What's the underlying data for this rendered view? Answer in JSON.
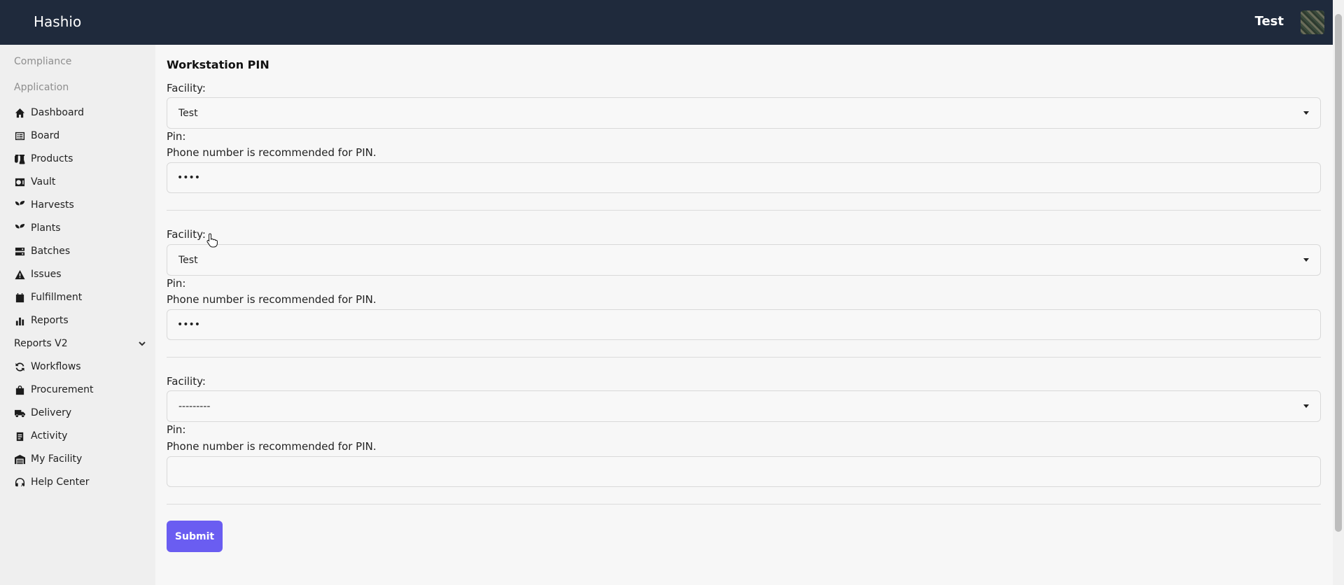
{
  "header": {
    "brand": "Hashio",
    "user_name": "Test"
  },
  "sidebar": {
    "section_compliance": "Compliance",
    "section_application": "Application",
    "items": [
      {
        "label": "Dashboard",
        "icon": "home-icon"
      },
      {
        "label": "Board",
        "icon": "board-icon"
      },
      {
        "label": "Products",
        "icon": "flask-icon"
      },
      {
        "label": "Vault",
        "icon": "vault-icon"
      },
      {
        "label": "Harvests",
        "icon": "seedling-icon"
      },
      {
        "label": "Plants",
        "icon": "seedling-icon"
      },
      {
        "label": "Batches",
        "icon": "layers-icon"
      },
      {
        "label": "Issues",
        "icon": "warning-icon"
      },
      {
        "label": "Fulfillment",
        "icon": "calendar-icon"
      },
      {
        "label": "Reports",
        "icon": "bar-chart-icon"
      },
      {
        "label": "Reports V2",
        "icon": "chevron-down-icon"
      },
      {
        "label": "Workflows",
        "icon": "recycle-icon"
      },
      {
        "label": "Procurement",
        "icon": "shopping-bag-icon"
      },
      {
        "label": "Delivery",
        "icon": "truck-icon"
      },
      {
        "label": "Activity",
        "icon": "clipboard-icon"
      },
      {
        "label": "My Facility",
        "icon": "warehouse-icon"
      },
      {
        "label": "Help Center",
        "icon": "headset-icon"
      }
    ]
  },
  "form": {
    "title": "Workstation PIN",
    "facility_label": "Facility:",
    "pin_label": "Pin:",
    "pin_hint": "Phone number is recommended for PIN.",
    "rows": [
      {
        "facility": "Test",
        "pin": "••••"
      },
      {
        "facility": "Test",
        "pin": "••••"
      },
      {
        "facility": "---------",
        "pin": ""
      }
    ],
    "submit_label": "Submit"
  },
  "colors": {
    "topbar": "#1f2a3c",
    "accent": "#6a5df1",
    "sidebar": "#efefef"
  }
}
